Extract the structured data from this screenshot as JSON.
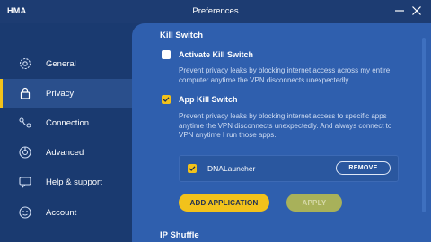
{
  "titlebar": {
    "app_name": "HMA",
    "title": "Preferences",
    "minimize_icon": "minimize-icon",
    "close_icon": "close-icon"
  },
  "sidebar": {
    "items": [
      {
        "label": "General",
        "icon": "gear-icon"
      },
      {
        "label": "Privacy",
        "icon": "lock-icon",
        "active": true
      },
      {
        "label": "Connection",
        "icon": "connection-icon"
      },
      {
        "label": "Advanced",
        "icon": "gear-cog-icon"
      },
      {
        "label": "Help & support",
        "icon": "chat-icon"
      },
      {
        "label": "Account",
        "icon": "avatar-icon"
      }
    ]
  },
  "kill_switch": {
    "title": "Kill Switch",
    "activate": {
      "label": "Activate Kill Switch",
      "checked": false,
      "description": "Prevent privacy leaks by blocking internet access across my entire computer anytime the VPN disconnects unexpectedly."
    },
    "app_kill": {
      "label": "App Kill Switch",
      "checked": true,
      "description": "Prevent privacy leaks by blocking internet access to specific apps anytime the VPN disconnects unexpectedly. And always connect to VPN anytime I run those apps."
    },
    "apps": [
      {
        "name": "DNALauncher",
        "checked": true,
        "remove_label": "REMOVE"
      }
    ],
    "add_label": "ADD APPLICATION",
    "apply_label": "APPLY"
  },
  "ip_shuffle": {
    "title": "IP Shuffle"
  },
  "colors": {
    "accent": "#f2c21b",
    "panel": "#2f5fae",
    "sidebar": "#1a3a70"
  }
}
